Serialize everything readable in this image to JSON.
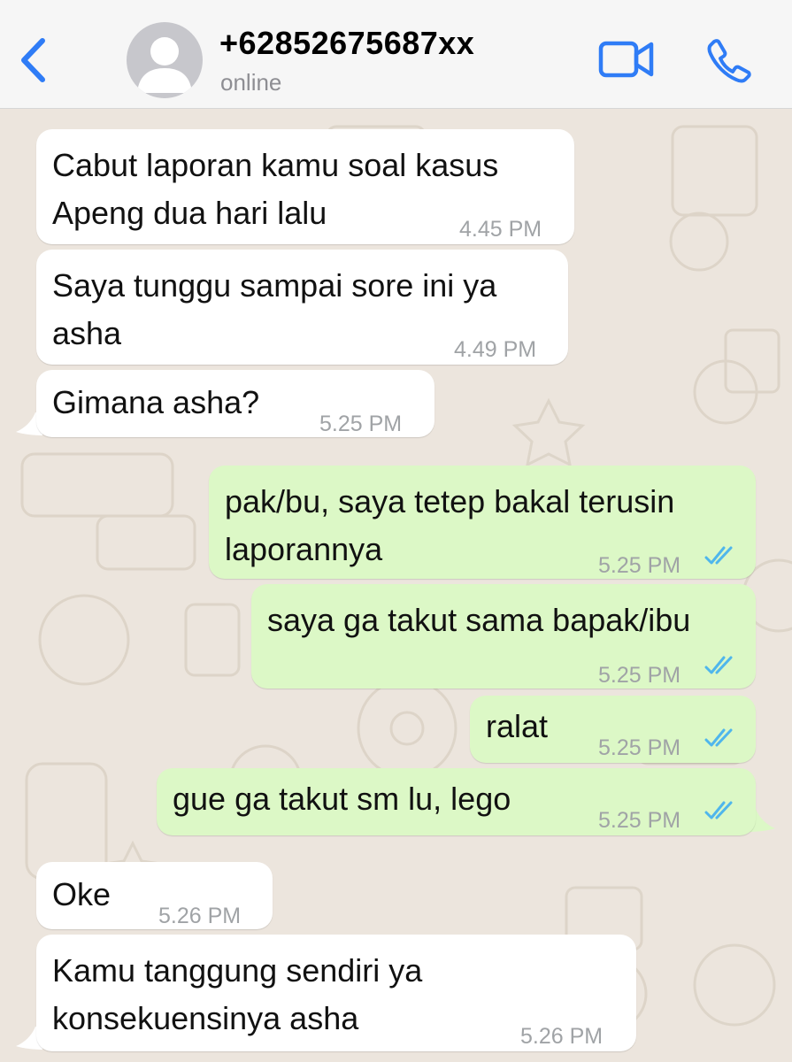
{
  "header": {
    "contact_name": "+62852675687xx",
    "status": "online"
  },
  "colors": {
    "accent": "#2f7cf6",
    "incoming_bubble": "#ffffff",
    "outgoing_bubble": "#dcf8c6",
    "read_ticks": "#4fb6ec",
    "timestamp": "#a0a3a6"
  },
  "icons": {
    "back": "chevron-left-icon",
    "avatar": "default-avatar-icon",
    "video": "video-camera-icon",
    "call": "phone-icon",
    "read": "double-check-icon"
  },
  "messages": [
    {
      "direction": "incoming",
      "lines": [
        "Cabut laporan kamu soal kasus",
        "Apeng dua hari lalu"
      ],
      "time": "4.45 PM"
    },
    {
      "direction": "incoming",
      "lines": [
        "Saya tunggu sampai sore ini ya",
        "asha"
      ],
      "time": "4.49 PM"
    },
    {
      "direction": "incoming",
      "lines": [
        "Gimana asha?"
      ],
      "time": "5.25 PM"
    },
    {
      "direction": "outgoing",
      "lines": [
        "pak/bu, saya tetep bakal terusin",
        "laporannya"
      ],
      "time": "5.25 PM",
      "status": "read"
    },
    {
      "direction": "outgoing",
      "lines": [
        "saya ga takut sama bapak/ibu"
      ],
      "time": "5.25 PM",
      "status": "read"
    },
    {
      "direction": "outgoing",
      "lines": [
        "ralat"
      ],
      "time": "5.25 PM",
      "status": "read"
    },
    {
      "direction": "outgoing",
      "lines": [
        "gue ga takut sm lu, lego"
      ],
      "time": "5.25 PM",
      "status": "read"
    },
    {
      "direction": "incoming",
      "lines": [
        "Oke"
      ],
      "time": "5.26 PM"
    },
    {
      "direction": "incoming",
      "lines": [
        "Kamu tanggung sendiri ya",
        "konsekuensinya asha"
      ],
      "time": "5.26 PM"
    }
  ]
}
